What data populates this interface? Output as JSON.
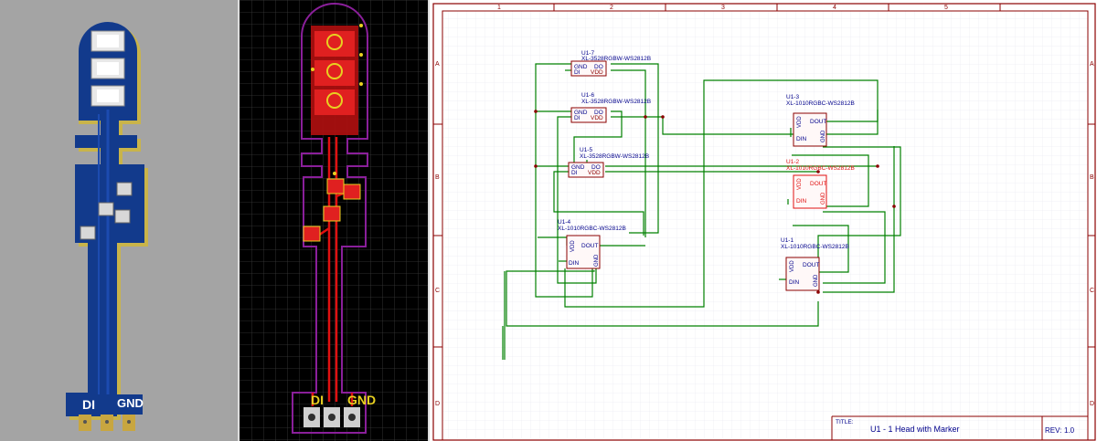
{
  "render3d": {
    "pad_labels": [
      "DI",
      "GND"
    ]
  },
  "pcb": {
    "pad_labels": [
      "DI",
      "GND"
    ]
  },
  "schematic": {
    "col_numbers": [
      "1",
      "2",
      "3",
      "4",
      "5"
    ],
    "row_letters": [
      "A",
      "B",
      "C",
      "D"
    ],
    "components": [
      {
        "ref": "U1-7",
        "part": "XL-3528RGBW-WS2812B",
        "pins": [
          "GND",
          "DO",
          "DI",
          "VDD"
        ]
      },
      {
        "ref": "U1-6",
        "part": "XL-3528RGBW-WS2812B",
        "pins": [
          "GND",
          "DO",
          "DI",
          "VDD"
        ]
      },
      {
        "ref": "U1-5",
        "part": "XL-3528RGBW-WS2812B",
        "pins": [
          "GND",
          "DO",
          "DI",
          "VDD"
        ]
      },
      {
        "ref": "U1-4",
        "part": "XL-1010RGBC-WS2812B",
        "pins": [
          "DOUT",
          "DIN",
          "VDD",
          "GND"
        ]
      },
      {
        "ref": "U1-3",
        "part": "XL-1010RGBC-WS2812B",
        "pins": [
          "DOUT",
          "DIN",
          "VDD",
          "GND"
        ]
      },
      {
        "ref": "U1-2",
        "part": "XL-1010RGBC-WS2812B",
        "pins": [
          "DOUT",
          "DIN",
          "VDD",
          "GND"
        ]
      },
      {
        "ref": "U1-1",
        "part": "XL-1010RGBC-WS2812B",
        "pins": [
          "DOUT",
          "DIN",
          "VDD",
          "GND"
        ]
      }
    ],
    "title_block": {
      "title_label": "TITLE:",
      "title": "U1 - 1 Head with Marker",
      "rev_label": "REV:",
      "rev": "1.0"
    }
  },
  "colors": {
    "board_blue": "#123a8c",
    "pcb_red": "#e01010",
    "pcb_outline": "#8a1f9a",
    "schematic_border": "#8b0000",
    "wire_green": "#008000",
    "text_blue": "#00008b"
  }
}
